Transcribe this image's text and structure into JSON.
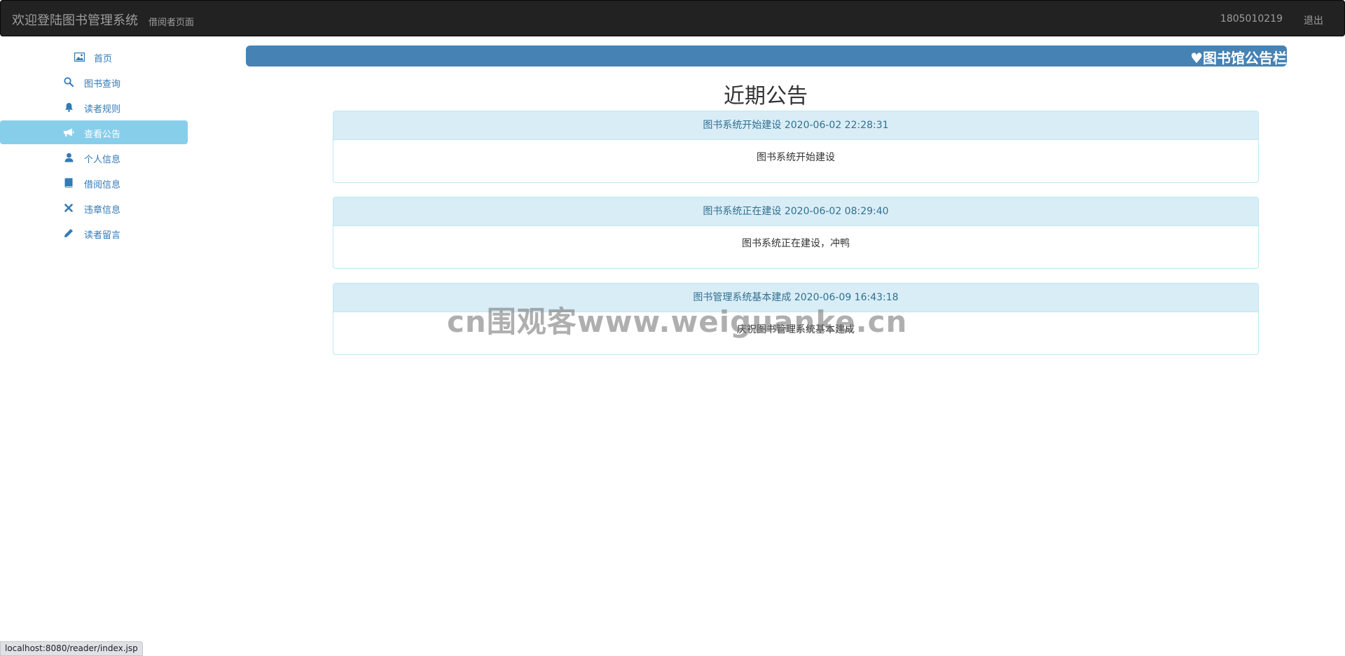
{
  "navbar": {
    "brand": "欢迎登陆图书管理系统",
    "subtitle": "借阅者页面",
    "user_id": "1805010219",
    "logout_label": "退出"
  },
  "sidebar": {
    "items": [
      {
        "label": "首页",
        "icon": "picture-icon"
      },
      {
        "label": "图书查询",
        "icon": "search-icon"
      },
      {
        "label": "读者规则",
        "icon": "bell-icon"
      },
      {
        "label": "查看公告",
        "icon": "bullhorn-icon",
        "active": true
      },
      {
        "label": "个人信息",
        "icon": "user-icon"
      },
      {
        "label": "借阅信息",
        "icon": "book-icon"
      },
      {
        "label": "违章信息",
        "icon": "close-icon"
      },
      {
        "label": "读者留言",
        "icon": "pencil-icon"
      }
    ]
  },
  "marquee": {
    "text": "♥图书馆公告栏"
  },
  "section": {
    "title": "近期公告"
  },
  "notices": [
    {
      "heading": "图书系统开始建设 2020-06-02 22:28:31",
      "body": "图书系统开始建设"
    },
    {
      "heading": "图书系统正在建设 2020-06-02 08:29:40",
      "body": "图书系统正在建设，冲鸭"
    },
    {
      "heading": "图书管理系统基本建成 2020-06-09 16:43:18",
      "body": "庆祝图书管理系统基本建成"
    }
  ],
  "watermark": {
    "text": "cn围观客www.weiguanke.cn"
  },
  "status_bar": {
    "url": "localhost:8080/reader/index.jsp"
  },
  "colors": {
    "navbar_bg": "#222222",
    "sidebar_active": "#87CEEB",
    "link": "#337ab7",
    "marquee_bg": "#4682B4",
    "panel_heading_bg": "#d9edf7",
    "panel_border": "#bce8f1"
  }
}
